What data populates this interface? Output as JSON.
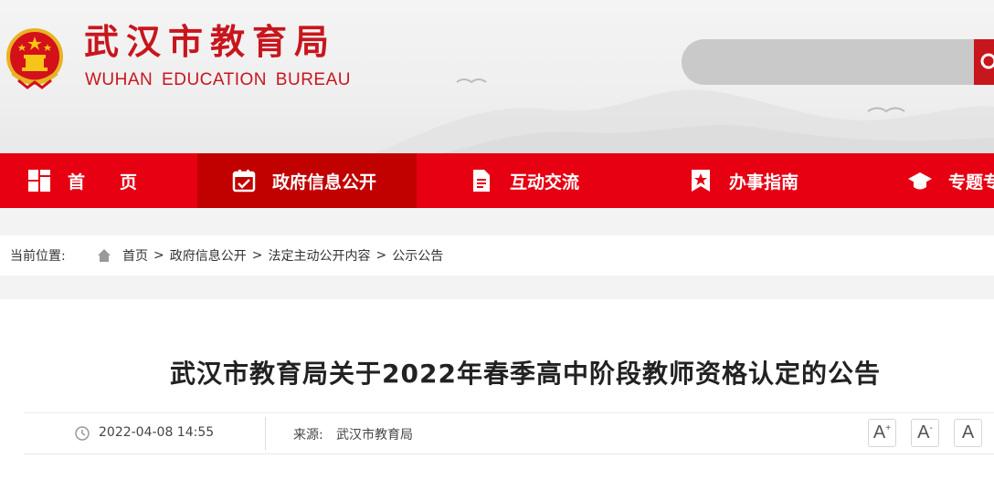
{
  "header": {
    "title_cn": "武汉市教育局",
    "title_en": "WUHAN EDUCATION BUREAU",
    "emblem_icon": "national-emblem-icon",
    "search": {
      "placeholder": "",
      "button_icon": "search-icon"
    }
  },
  "nav": {
    "items": [
      {
        "label": "首　　页",
        "icon": "home-grid-icon",
        "active": false
      },
      {
        "label": "政府信息公开",
        "icon": "calendar-check-icon",
        "active": true
      },
      {
        "label": "互动交流",
        "icon": "document-icon",
        "active": false
      },
      {
        "label": "办事指南",
        "icon": "star-badge-icon",
        "active": false
      },
      {
        "label": "专题专",
        "icon": "graduation-cap-icon",
        "active": false
      }
    ]
  },
  "breadcrumb": {
    "prefix": "当前位置:",
    "items": [
      "首页",
      "政府信息公开",
      "法定主动公开内容",
      "公示公告"
    ],
    "separator": ">"
  },
  "article": {
    "title": "武汉市教育局关于2022年春季高中阶段教师资格认定的公告",
    "date": "2022-04-08 14:55",
    "source_label": "来源:",
    "source": "武汉市教育局",
    "font_buttons": [
      "A",
      "A",
      "A"
    ],
    "font_button_marks": [
      "+",
      "-",
      ""
    ]
  },
  "colors": {
    "brand_red": "#e60012",
    "active_nav": "#c10000",
    "title_red": "#c8161d"
  }
}
